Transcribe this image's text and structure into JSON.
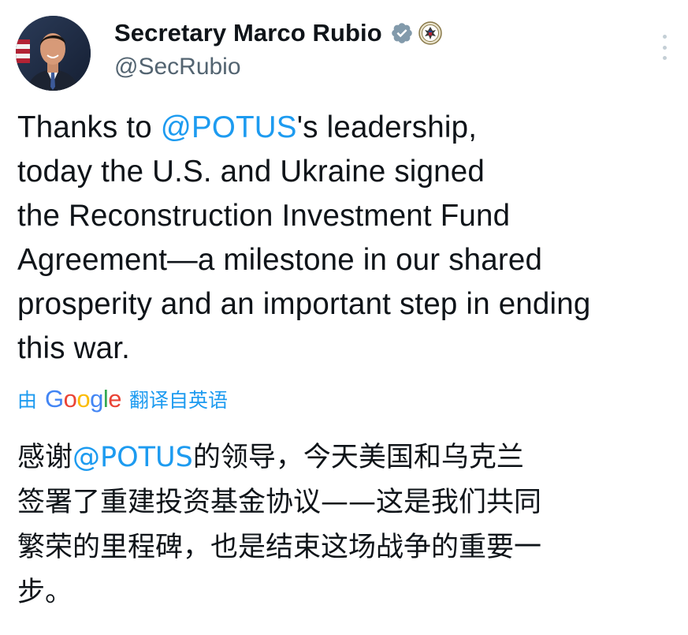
{
  "author": {
    "display_name": "Secretary Marco Rubio",
    "handle": "@SecRubio",
    "avatar": "avatar-photo",
    "verified_icon": "verified-badge-icon",
    "affiliation_icon": "state-department-seal-icon"
  },
  "more_icon": "more-options-icon",
  "tweet": {
    "lines": [
      {
        "pre": "Thanks to ",
        "mention": "@POTUS",
        "post": "'s leadership,"
      },
      {
        "text": "today the U.S. and Ukraine signed"
      },
      {
        "text": "the Reconstruction Investment Fund"
      },
      {
        "text": "Agreement—a milestone in our shared"
      },
      {
        "text": "prosperity and an important step in ending"
      },
      {
        "text": "this war."
      }
    ]
  },
  "translation": {
    "prefix": "由",
    "provider": [
      "G",
      "o",
      "o",
      "g",
      "l",
      "e"
    ],
    "suffix": "翻译自英语",
    "lines": [
      {
        "pre": "感谢",
        "mention": "@POTUS",
        "post": "的领导，今天美国和乌克兰"
      },
      {
        "text": "签署了重建投资基金协议——这是我们共同"
      },
      {
        "text": "繁荣的里程碑，也是结束这场战争的重要一"
      },
      {
        "text": "步。"
      }
    ]
  },
  "colors": {
    "text": "#0f1419",
    "secondary": "#536471",
    "link": "#1d9bf0",
    "google_blue": "#4285f4",
    "google_red": "#ea4335",
    "google_yellow": "#fbbc05",
    "google_green": "#34a853"
  }
}
